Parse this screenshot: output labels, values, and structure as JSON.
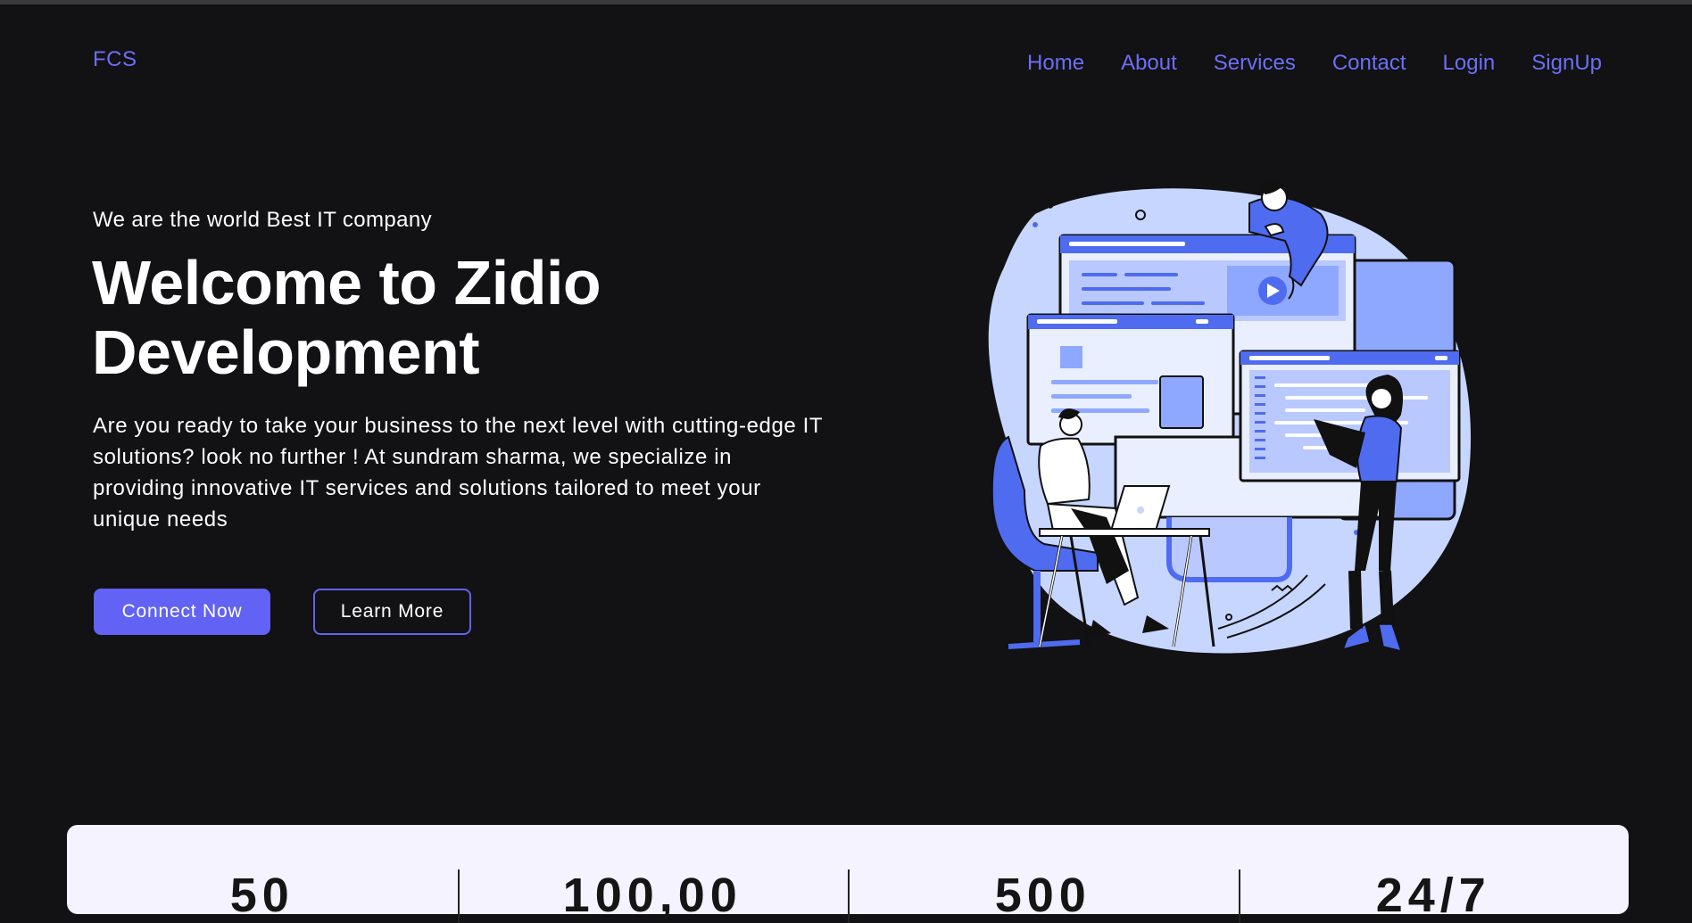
{
  "brand": {
    "name": "FCS"
  },
  "nav": {
    "items": [
      {
        "label": "Home"
      },
      {
        "label": "About"
      },
      {
        "label": "Services"
      },
      {
        "label": "Contact"
      },
      {
        "label": "Login"
      },
      {
        "label": "SignUp"
      }
    ]
  },
  "hero": {
    "eyebrow": "We are the world Best IT company",
    "title_line1": "Welcome to Zidio",
    "title_line2": "Development",
    "description": "Are you ready to take your business to the next level with cutting-edge IT solutions? look no further ! At sundram sharma, we specialize in providing innovative IT services and solutions tailored to meet your unique needs",
    "primary_button": "Connect Now",
    "secondary_button": "Learn More"
  },
  "stats": {
    "items": [
      {
        "value": "50"
      },
      {
        "value": "100,00"
      },
      {
        "value": "500"
      },
      {
        "value": "24/7"
      }
    ]
  },
  "colors": {
    "background": "#121113",
    "accent": "#6262f4",
    "nav_link": "#6c6ff5",
    "illustration_blue": "#4f6bf0",
    "illustration_light": "#c7d6ff",
    "stats_panel": "#f4f3ff"
  }
}
